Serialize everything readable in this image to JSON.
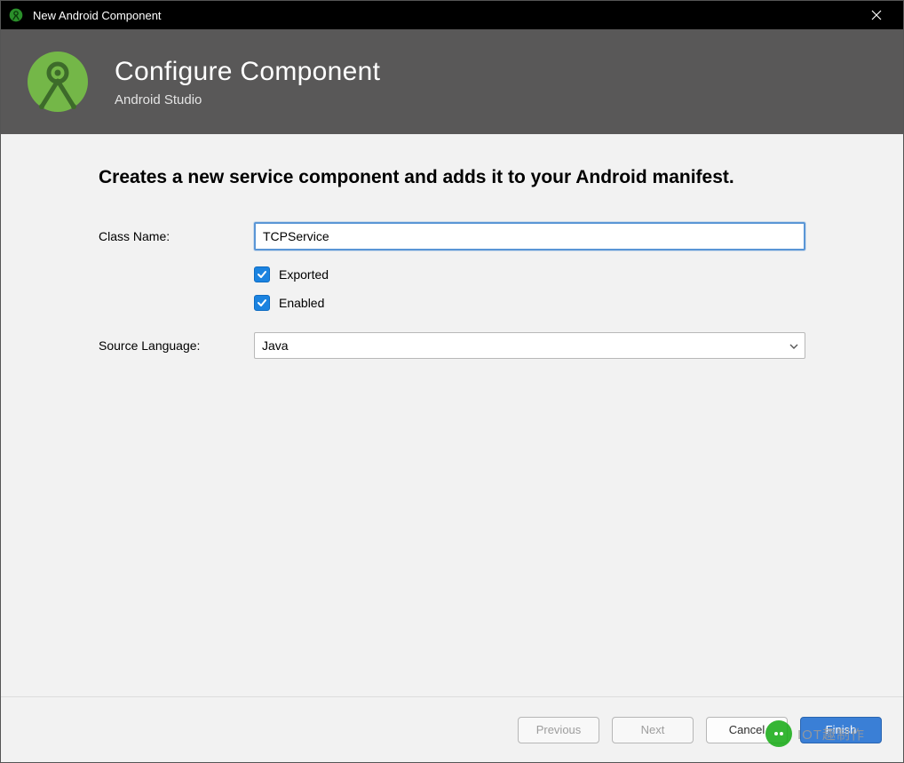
{
  "window": {
    "title": "New Android Component"
  },
  "banner": {
    "title": "Configure Component",
    "subtitle": "Android Studio"
  },
  "content": {
    "description": "Creates a new service component and adds it to your Android manifest.",
    "classNameLabel": "Class Name:",
    "classNameValue": "TCPService",
    "exportedLabel": "Exported",
    "exportedChecked": true,
    "enabledLabel": "Enabled",
    "enabledChecked": true,
    "sourceLanguageLabel": "Source Language:",
    "sourceLanguageValue": "Java"
  },
  "footer": {
    "previous": "Previous",
    "next": "Next",
    "cancel": "Cancel",
    "finish": "Finish"
  },
  "watermark": {
    "text": "IOT趣制作"
  }
}
